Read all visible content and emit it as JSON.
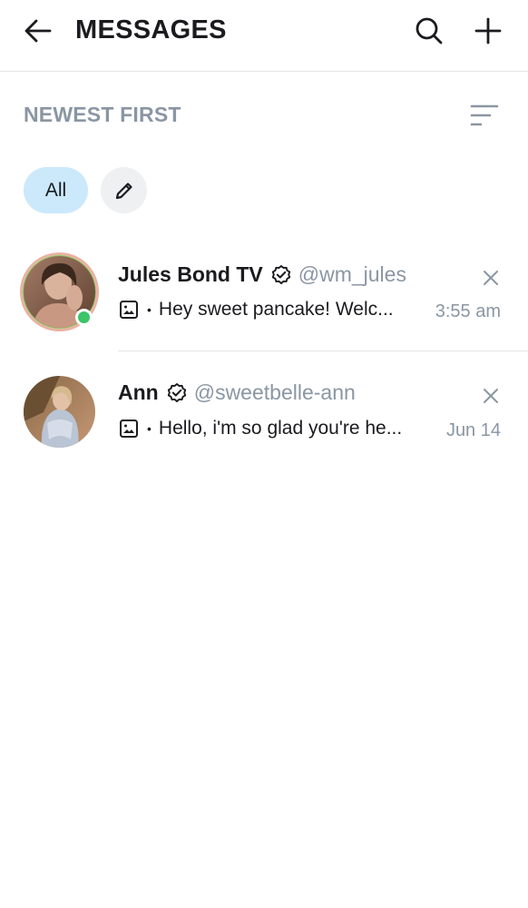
{
  "header": {
    "title": "MESSAGES",
    "back_icon": "arrow-left-icon",
    "search_icon": "search-icon",
    "add_icon": "plus-icon"
  },
  "sort": {
    "label": "NEWEST FIRST",
    "icon": "sort-lines-icon"
  },
  "filters": {
    "all_label": "All",
    "edit_icon": "pencil-icon",
    "active_color": "#cbe9fb"
  },
  "conversations": [
    {
      "name": "Jules Bond TV",
      "verified": true,
      "handle": "@wm_jules",
      "preview": "Hey sweet pancake! Welc...",
      "time": "3:55 am",
      "online": true,
      "has_story_ring": true
    },
    {
      "name": "Ann",
      "verified": true,
      "handle": "@sweetbelle-ann",
      "preview": "Hello, i'm so glad you're he...",
      "time": "Jun 14",
      "online": false,
      "has_story_ring": false
    }
  ],
  "colors": {
    "text_primary": "#1b1b1f",
    "text_muted": "#8a96a3",
    "online": "#3bc468",
    "divider": "#e3e5e8"
  }
}
